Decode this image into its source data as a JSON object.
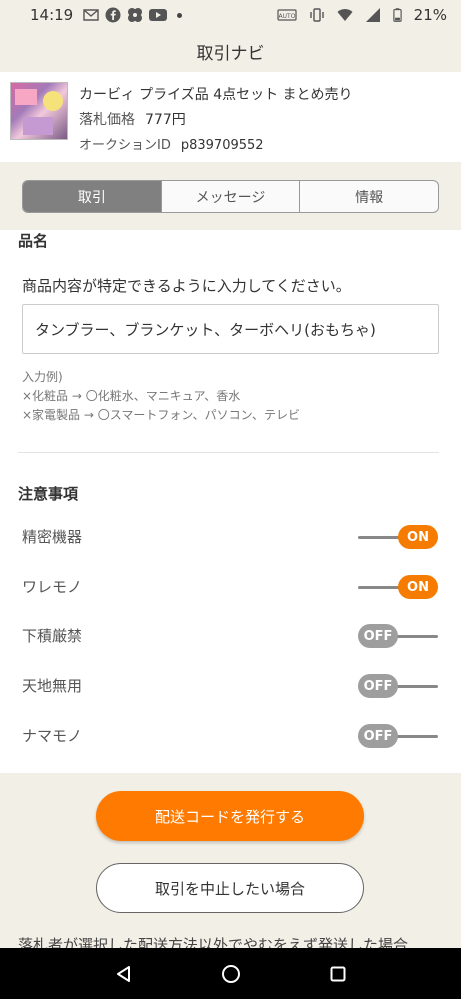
{
  "status_bar": {
    "time": "14:19",
    "battery": "21%",
    "icons": [
      "gmail-icon",
      "facebook-icon",
      "pinwheel-icon",
      "youtube-icon",
      "dot-icon",
      "auto-icon",
      "vibrate-icon",
      "wifi-icon",
      "signal-icon",
      "battery-icon"
    ]
  },
  "header": {
    "title": "取引ナビ"
  },
  "item": {
    "title": "カービィ プライズ品 4点セット まとめ売り",
    "price_label": "落札価格",
    "price": "777円",
    "auction_label": "オークションID",
    "auction_id": "p839709552"
  },
  "tabs": [
    {
      "label": "取引",
      "active": true
    },
    {
      "label": "メッセージ",
      "active": false
    },
    {
      "label": "情報",
      "active": false
    }
  ],
  "product": {
    "section_title": "品名",
    "instruction": "商品内容が特定できるように入力してください。",
    "value": "タンブラー、ブランケット、ターボヘリ(おもちゃ)",
    "example_title": "入力例)",
    "example_1": "×化粧品 → 〇化粧水、マニキュア、香水",
    "example_2": "×家電製品 → 〇スマートフォン、パソコン、テレビ"
  },
  "cautions": {
    "section_title": "注意事項",
    "items": [
      {
        "label": "精密機器",
        "state": "ON"
      },
      {
        "label": "ワレモノ",
        "state": "ON"
      },
      {
        "label": "下積厳禁",
        "state": "OFF"
      },
      {
        "label": "天地無用",
        "state": "OFF"
      },
      {
        "label": "ナマモノ",
        "state": "OFF"
      }
    ]
  },
  "buttons": {
    "issue_code": "配送コードを発行する",
    "cancel_trade": "取引を中止したい場合"
  },
  "footer_text": "落札者が選択した配送方法以外でやむをえず発送した場合",
  "colors": {
    "accent": "#ff7a00",
    "toggle_on": "#f57c00",
    "toggle_off": "#9e9e9e",
    "active_tab": "#808080",
    "background": "#f2efe7"
  }
}
